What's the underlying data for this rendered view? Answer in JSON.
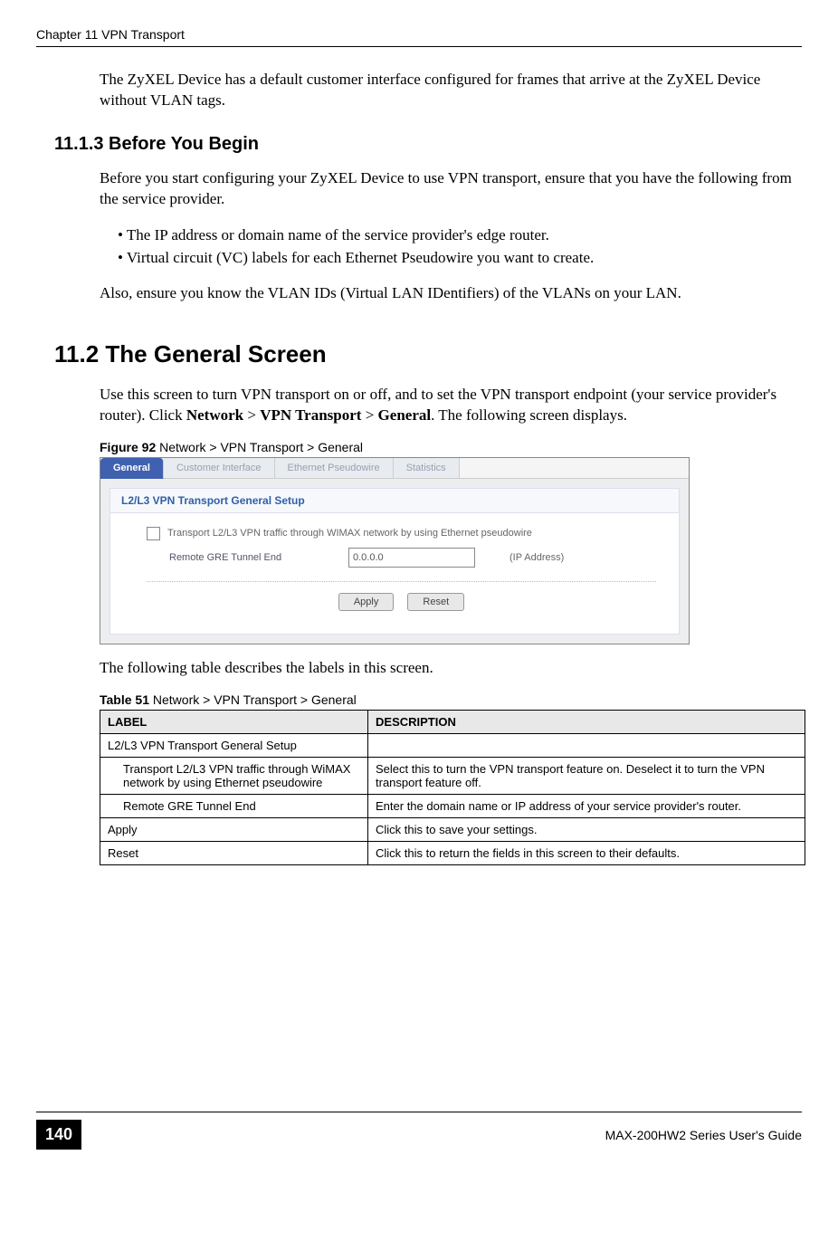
{
  "running_header": "Chapter 11 VPN Transport",
  "intro_para": "The ZyXEL Device has a default customer interface configured for frames that arrive at the ZyXEL Device without VLAN tags.",
  "section_1113": {
    "heading": "11.1.3  Before You Begin",
    "para1": "Before you start configuring your ZyXEL Device to use VPN transport, ensure that you have the following from the service provider.",
    "bullets": [
      "The IP address or domain name of the service provider's edge router.",
      "Virtual circuit (VC) labels for each Ethernet Pseudowire you want to create."
    ],
    "para2": "Also, ensure you know the VLAN IDs (Virtual LAN IDentifiers) of the VLANs on your LAN."
  },
  "section_112": {
    "heading": "11.2  The General Screen",
    "para_parts": {
      "p1": "Use this screen to turn VPN transport on or off, and to set the VPN transport endpoint (your service provider's router). Click ",
      "nav1": "Network",
      "sep": " > ",
      "nav2": "VPN Transport",
      "nav3": "General",
      "p2": ". The following screen displays."
    }
  },
  "figure": {
    "caption_prefix": "Figure 92   ",
    "caption_text": "Network > VPN Transport > General",
    "tabs": [
      "General",
      "Customer Interface",
      "Ethernet Pseudowire",
      "Statistics"
    ],
    "panel_title": "L2/L3 VPN Transport General Setup",
    "checkbox_label": "Transport L2/L3 VPN traffic through WIMAX network by using Ethernet pseudowire",
    "field_label": "Remote GRE Tunnel End",
    "field_value": "0.0.0.0",
    "field_hint": "(IP Address)",
    "btn_apply": "Apply",
    "btn_reset": "Reset"
  },
  "table_intro": "The following table describes the labels in this screen.",
  "table": {
    "caption_prefix": "Table 51   ",
    "caption_text": "Network > VPN Transport > General",
    "headers": [
      "LABEL",
      "DESCRIPTION"
    ],
    "rows": [
      {
        "label": "L2/L3 VPN Transport General Setup",
        "desc": "",
        "indent": false
      },
      {
        "label": "Transport L2/L3 VPN traffic through WiMAX network by using Ethernet pseudowire",
        "desc": "Select this to turn the VPN transport feature on. Deselect it to turn the VPN transport feature off.",
        "indent": true
      },
      {
        "label": "Remote GRE Tunnel End",
        "desc": "Enter the domain name or IP address of your service provider's router.",
        "indent": true
      },
      {
        "label": "Apply",
        "desc": "Click this to save your settings.",
        "indent": false
      },
      {
        "label": "Reset",
        "desc": "Click this to return the fields in this screen to their defaults.",
        "indent": false
      }
    ]
  },
  "footer": {
    "page_number": "140",
    "guide_name": "MAX-200HW2 Series User's Guide"
  }
}
